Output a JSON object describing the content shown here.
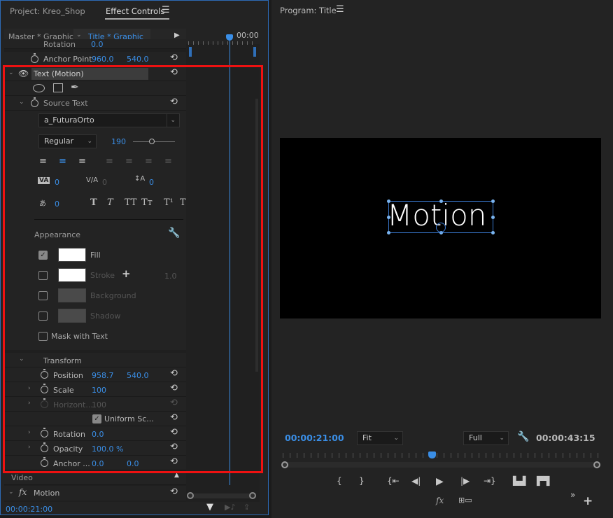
{
  "left_panel": {
    "tabs": [
      {
        "label": "Project: Kreo_Shop",
        "active": false
      },
      {
        "label": "Effect Controls",
        "active": true
      }
    ],
    "menu_icon": "hamburger-icon",
    "clip_source": "Master * Graphic",
    "clip_target": "Title * Graphic",
    "timeline_time": "00:00",
    "top_rows": [
      {
        "label": "Rotation",
        "v1": "0.0"
      },
      {
        "label": "Anchor Point",
        "v1": "960.0",
        "v2": "540.0"
      }
    ],
    "text_layer": {
      "label": "Text (Motion)",
      "source_text_label": "Source Text",
      "font": "a_FuturaOrto",
      "style": "Regular",
      "size": "190",
      "size_slider_fraction": 0.45,
      "tracking_values": {
        "kerning": "0",
        "tracking": "0",
        "leading": "0",
        "tsume": "0"
      },
      "text_style_buttons": [
        "T",
        "T",
        "TT",
        "Tт",
        "T¹",
        "T"
      ],
      "appearance_label": "Appearance",
      "appearance": [
        {
          "label": "Fill",
          "checked": true,
          "color": "#ffffff",
          "enabled": true
        },
        {
          "label": "Stroke",
          "checked": false,
          "color": "#ffffff",
          "enabled": false,
          "width": "1.0"
        },
        {
          "label": "Background",
          "checked": false,
          "color": "#4a4a4a",
          "enabled": false
        },
        {
          "label": "Shadow",
          "checked": false,
          "color": "#4a4a4a",
          "enabled": false
        }
      ],
      "mask_with_text": "Mask with Text"
    },
    "transform": {
      "label": "Transform",
      "rows": [
        {
          "label": "Position",
          "v1": "958.7",
          "v2": "540.0",
          "expandable": false,
          "enabled": true
        },
        {
          "label": "Scale",
          "v1": "100",
          "expandable": true,
          "enabled": true
        },
        {
          "label": "Horizont...",
          "v1": "100",
          "expandable": true,
          "enabled": false
        },
        {
          "label": "Uniform Sc...",
          "checkbox": true
        },
        {
          "label": "Rotation",
          "v1": "0.0",
          "expandable": true,
          "enabled": true
        },
        {
          "label": "Opacity",
          "v1": "100.0 %",
          "expandable": true,
          "enabled": true
        },
        {
          "label": "Anchor ...",
          "v1": "0.0",
          "v2": "0.0",
          "expandable": false,
          "enabled": true
        }
      ]
    },
    "video_section": "Video",
    "motion_fx": {
      "fx": "fx",
      "label": "Motion"
    },
    "current_time": "00:00:21:00"
  },
  "program_monitor": {
    "title": "Program: Title",
    "menu_icon": "hamburger-icon",
    "preview_text": "Motion",
    "current_time": "00:00:21:00",
    "zoom": "Fit",
    "resolution": "Full",
    "duration": "00:00:43:15",
    "playhead_fraction": 0.47,
    "fx_label": "fx"
  },
  "colors": {
    "accent": "#3a8ee6",
    "highlight": "#e11111",
    "panel_bg": "#232323"
  }
}
